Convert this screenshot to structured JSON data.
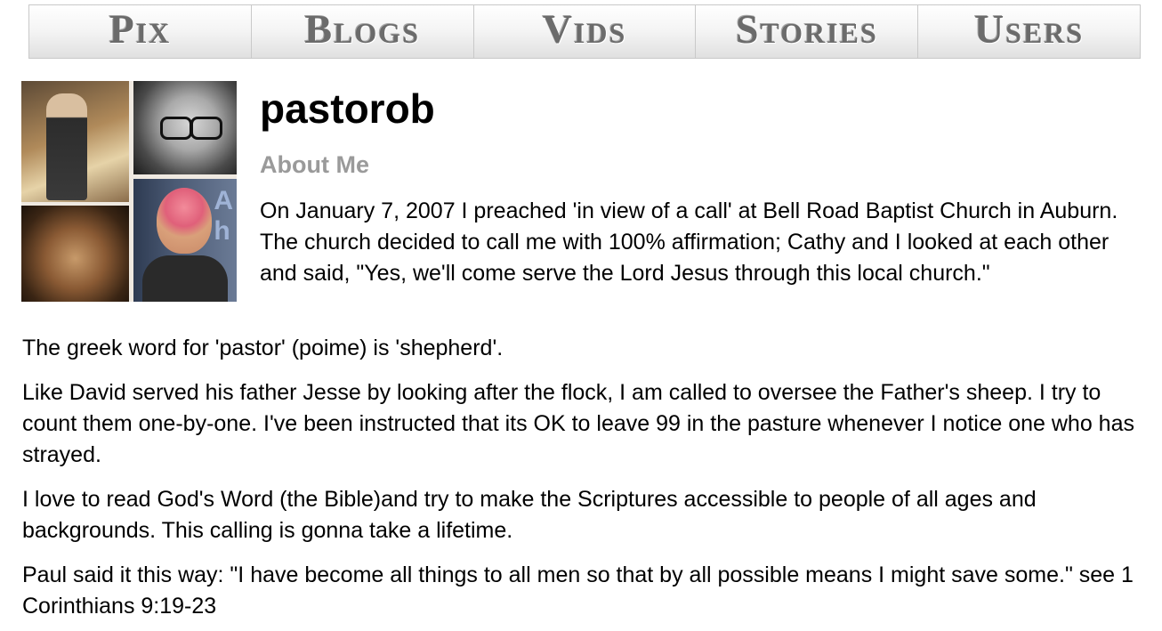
{
  "nav": {
    "tabs": [
      {
        "label": "Pix"
      },
      {
        "label": "Blogs"
      },
      {
        "label": "Vids"
      },
      {
        "label": "Stories"
      },
      {
        "label": "Users"
      }
    ]
  },
  "profile": {
    "username": "pastorob",
    "about_heading": "About Me",
    "paragraphs": [
      "On January 7, 2007 I preached 'in view of a call' at Bell Road Baptist Church in Auburn. The church decided to call me with 100% affirmation; Cathy and I looked at each other and said, \"Yes, we'll come serve the Lord Jesus through this local church.\"",
      "The greek word for 'pastor' (poime) is 'shepherd'.",
      "Like David served his father Jesse by looking after the flock, I am called to oversee the Father's sheep. I try to count them one-by-one. I've been instructed that its OK to leave 99 in the pasture whenever  I notice one who has strayed.",
      "I love to read God's Word (the Bible)and try to make the Scriptures accessible to people of all ages and backgrounds. This calling is gonna take a lifetime.",
      "Paul said it this way: \"I have become all things to all men so that by all possible means I might save some.\" see 1 Corinthians 9:19-23"
    ]
  },
  "colors": {
    "about_heading": "#9a9a9a",
    "tab_text": "#6b6b6b",
    "tab_border": "#c9c9c9"
  }
}
